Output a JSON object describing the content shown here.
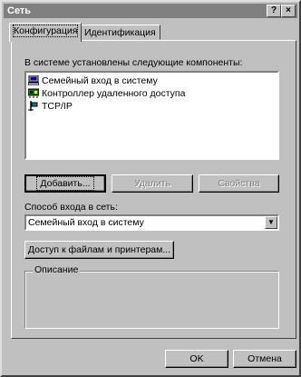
{
  "window": {
    "title": "Сеть",
    "help_button": "?",
    "close_button": "×"
  },
  "tabs": [
    {
      "label": "Конфигурация",
      "active": true
    },
    {
      "label": "Идентификация",
      "active": false
    }
  ],
  "components": {
    "heading": "В системе установлены следующие компоненты:",
    "items": [
      {
        "label": "Семейный вход в систему",
        "icon": "computer-icon"
      },
      {
        "label": "Контроллер удаленного доступа",
        "icon": "network-adapter-icon"
      },
      {
        "label": "TCP/IP",
        "icon": "protocol-icon"
      }
    ]
  },
  "buttons": {
    "add": "Добавить...",
    "remove": "Удалить",
    "properties": "Свойства",
    "file_print_sharing": "Доступ к файлам и принтерам...",
    "ok": "OK",
    "cancel": "Отмена"
  },
  "logon": {
    "label": "Способ входа в сеть:",
    "selected": "Семейный вход в систему"
  },
  "description": {
    "label": "Описание"
  },
  "colors": {
    "face": "#c0c0c0",
    "titlebar_inactive": "#808080",
    "disabled_text": "#808080"
  }
}
